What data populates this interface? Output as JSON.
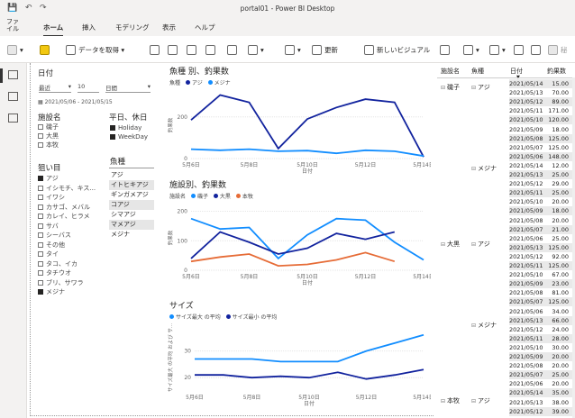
{
  "window": {
    "title": "portal01 - Power BI Desktop"
  },
  "menu": {
    "file": "ファイル",
    "home": "ホーム",
    "insert": "挿入",
    "modeling": "モデリング",
    "view": "表示",
    "help": "ヘルプ"
  },
  "ribbon": {
    "get_data": "データを取得",
    "refresh": "更新",
    "new_visual": "新しいビジュアル",
    "secret_partial": "秘"
  },
  "date_slicer": {
    "title": "日付",
    "mode": "最近",
    "count": "10",
    "unit": "日間",
    "range": "2021/05/06 - 2021/05/15"
  },
  "facility_slicer": {
    "title": "施設名",
    "items": [
      {
        "label": "磯子",
        "checked": false
      },
      {
        "label": "大黒",
        "checked": false
      },
      {
        "label": "本牧",
        "checked": false
      }
    ]
  },
  "weekday_slicer": {
    "title": "平日、休日",
    "items": [
      {
        "label": "Holiday",
        "checked": true
      },
      {
        "label": "WeekDay",
        "checked": true
      }
    ]
  },
  "target_slicer": {
    "title": "狙い目",
    "items": [
      {
        "label": "アジ",
        "checked": true
      },
      {
        "label": "イシモチ、キス...",
        "checked": false
      },
      {
        "label": "イワシ",
        "checked": false
      },
      {
        "label": "カサゴ、メバル",
        "checked": false
      },
      {
        "label": "カレイ、ヒラメ",
        "checked": false
      },
      {
        "label": "サバ",
        "checked": false
      },
      {
        "label": "シーバス",
        "checked": false
      },
      {
        "label": "その他",
        "checked": false
      },
      {
        "label": "タイ",
        "checked": false
      },
      {
        "label": "タコ、イカ",
        "checked": false
      },
      {
        "label": "タチウオ",
        "checked": false
      },
      {
        "label": "ブリ、サワラ",
        "checked": false
      },
      {
        "label": "メジナ",
        "checked": true
      }
    ]
  },
  "fish_slicer": {
    "title": "魚種",
    "items": [
      {
        "label": "アジ",
        "selected": false
      },
      {
        "label": "イトヒキアジ",
        "selected": true
      },
      {
        "label": "ギンガメアジ",
        "selected": false
      },
      {
        "label": "コアジ",
        "selected": true
      },
      {
        "label": "シマアジ",
        "selected": false
      },
      {
        "label": "マメアジ",
        "selected": true
      },
      {
        "label": "メジナ",
        "selected": false
      }
    ]
  },
  "chart_data": [
    {
      "type": "line",
      "title": "魚種 別、釣果数",
      "legend_title": "魚種",
      "x": [
        "5月6日",
        "5月7日",
        "5月8日",
        "5月9日",
        "5月10日",
        "5月11日",
        "5月12日",
        "5月13日",
        "5月14日"
      ],
      "xticks": [
        "5月6日",
        "5月8日",
        "5月10日",
        "5月12日",
        "5月14日"
      ],
      "xlabel": "日付",
      "ylabel": "釣果数",
      "yticks": [
        0,
        200
      ],
      "ylim": [
        0,
        320
      ],
      "series": [
        {
          "name": "アジ",
          "color": "#12239e",
          "values": [
            185,
            305,
            270,
            48,
            190,
            245,
            285,
            270,
            8
          ]
        },
        {
          "name": "メジナ",
          "color": "#118dff",
          "values": [
            45,
            40,
            45,
            35,
            38,
            25,
            40,
            35,
            12
          ]
        }
      ]
    },
    {
      "type": "line",
      "title": "施設別、釣果数",
      "legend_title": "施設名",
      "x": [
        "5月6日",
        "5月7日",
        "5月8日",
        "5月9日",
        "5月10日",
        "5月11日",
        "5月12日",
        "5月13日",
        "5月14日"
      ],
      "xticks": [
        "5月6日",
        "5月8日",
        "5月10日",
        "5月12日",
        "5月14日"
      ],
      "xlabel": "日付",
      "ylabel": "釣果数",
      "yticks": [
        0,
        100,
        200
      ],
      "ylim": [
        0,
        220
      ],
      "series": [
        {
          "name": "磯子",
          "color": "#118dff",
          "values": [
            175,
            140,
            145,
            40,
            120,
            175,
            170,
            95,
            35
          ]
        },
        {
          "name": "大黒",
          "color": "#12239e",
          "values": [
            40,
            130,
            95,
            55,
            75,
            125,
            105,
            130,
            null
          ]
        },
        {
          "name": "本牧",
          "color": "#e66c37",
          "values": [
            30,
            45,
            55,
            15,
            20,
            35,
            60,
            30,
            null
          ]
        }
      ]
    },
    {
      "type": "line",
      "title": "サイズ",
      "x": [
        "5月6日",
        "5月7日",
        "5月8日",
        "5月9日",
        "5月10日",
        "5月11日",
        "5月12日",
        "5月13日",
        "5月14日"
      ],
      "xticks": [
        "5月6日",
        "5月8日",
        "5月10日",
        "5月12日",
        "5月14日"
      ],
      "xlabel": "日付",
      "ylabel": "サイズ最大 の平均 および サ...",
      "yticks": [
        20,
        30
      ],
      "ylim": [
        15,
        40
      ],
      "series": [
        {
          "name": "サイズ最大 の平均",
          "color": "#118dff",
          "values": [
            27,
            27,
            27,
            26,
            26,
            26,
            30,
            33,
            36
          ]
        },
        {
          "name": "サイズ最小 の平均",
          "color": "#12239e",
          "values": [
            21,
            21,
            20,
            20.5,
            20,
            22,
            19.5,
            21,
            23
          ]
        }
      ]
    }
  ],
  "table": {
    "headers": [
      "施設名",
      "魚種",
      "日付",
      "釣果数"
    ],
    "groups": [
      {
        "facility": "磯子",
        "fish": "アジ"
      },
      {
        "facility": "",
        "fish": "メジナ"
      },
      {
        "facility": "大黒",
        "fish": "アジ"
      },
      {
        "facility": "",
        "fish": "メジナ"
      },
      {
        "facility": "本牧",
        "fish": "アジ"
      }
    ],
    "rows": [
      [
        "2021/05/14",
        "15.00"
      ],
      [
        "2021/05/13",
        "70.00"
      ],
      [
        "2021/05/12",
        "89.00"
      ],
      [
        "2021/05/11",
        "171.00"
      ],
      [
        "2021/05/10",
        "120.00"
      ],
      [
        "2021/05/09",
        "18.00"
      ],
      [
        "2021/05/08",
        "125.00"
      ],
      [
        "2021/05/07",
        "125.00"
      ],
      [
        "2021/05/06",
        "148.00"
      ],
      [
        "2021/05/14",
        "12.00"
      ],
      [
        "2021/05/13",
        "25.00"
      ],
      [
        "2021/05/12",
        "29.00"
      ],
      [
        "2021/05/11",
        "25.00"
      ],
      [
        "2021/05/10",
        "20.00"
      ],
      [
        "2021/05/09",
        "18.00"
      ],
      [
        "2021/05/08",
        "20.00"
      ],
      [
        "2021/05/07",
        "21.00"
      ],
      [
        "2021/05/06",
        "25.00"
      ],
      [
        "2021/05/13",
        "125.00"
      ],
      [
        "2021/05/12",
        "92.00"
      ],
      [
        "2021/05/11",
        "125.00"
      ],
      [
        "2021/05/10",
        "67.00"
      ],
      [
        "2021/05/09",
        "23.00"
      ],
      [
        "2021/05/08",
        "81.00"
      ],
      [
        "2021/05/07",
        "125.00"
      ],
      [
        "2021/05/06",
        "34.00"
      ],
      [
        "2021/05/13",
        "66.00"
      ],
      [
        "2021/05/12",
        "24.00"
      ],
      [
        "2021/05/11",
        "28.00"
      ],
      [
        "2021/05/10",
        "30.00"
      ],
      [
        "2021/05/09",
        "20.00"
      ],
      [
        "2021/05/08",
        "20.00"
      ],
      [
        "2021/05/07",
        "25.00"
      ],
      [
        "2021/05/06",
        "20.00"
      ],
      [
        "2021/05/14",
        "35.00"
      ],
      [
        "2021/05/13",
        "38.00"
      ],
      [
        "2021/05/12",
        "39.00"
      ]
    ]
  }
}
